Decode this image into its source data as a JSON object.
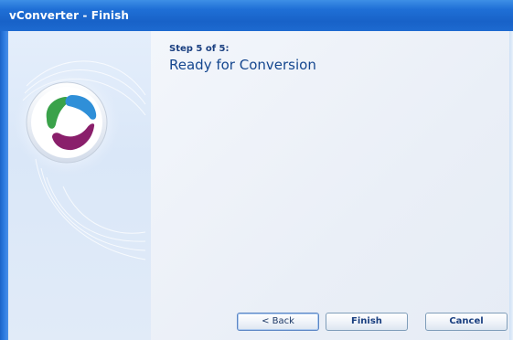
{
  "window": {
    "title": "vConverter - Finish"
  },
  "wizard": {
    "step_label": "Step 5 of 5:",
    "step_title": "Ready for Conversion"
  },
  "buttons": {
    "back_label": "< Back",
    "finish_label": "Finish",
    "cancel_label": "Cancel"
  },
  "colors": {
    "titlebar": "#1f6fd6",
    "logo_green": "#3aa24a",
    "logo_blue": "#2f8fd8",
    "logo_purple": "#8a1f6b"
  }
}
